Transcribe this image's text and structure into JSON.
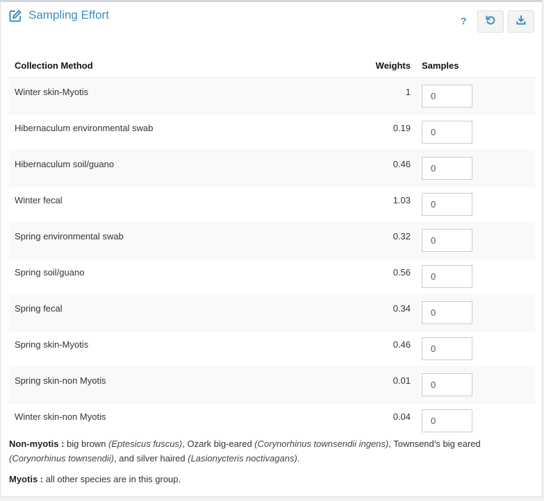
{
  "header": {
    "title": "Sampling Effort",
    "help_label": "?",
    "icons": {
      "title": "edit-icon",
      "reset": "undo-icon",
      "download": "download-icon"
    }
  },
  "table": {
    "columns": [
      "Collection Method",
      "Weights",
      "Samples"
    ],
    "rows": [
      {
        "method": "Winter skin-Myotis",
        "weight": "1",
        "samples": "0"
      },
      {
        "method": "Hibernaculum environmental swab",
        "weight": "0.19",
        "samples": "0"
      },
      {
        "method": "Hibernaculum soil/guano",
        "weight": "0.46",
        "samples": "0"
      },
      {
        "method": "Winter fecal",
        "weight": "1.03",
        "samples": "0"
      },
      {
        "method": "Spring environmental swab",
        "weight": "0.32",
        "samples": "0"
      },
      {
        "method": "Spring soil/guano",
        "weight": "0.56",
        "samples": "0"
      },
      {
        "method": "Spring fecal",
        "weight": "0.34",
        "samples": "0"
      },
      {
        "method": "Spring skin-Myotis",
        "weight": "0.46",
        "samples": "0"
      },
      {
        "method": "Spring skin-non Myotis",
        "weight": "0.01",
        "samples": "0"
      },
      {
        "method": "Winter skin-non Myotis",
        "weight": "0.04",
        "samples": "0"
      }
    ]
  },
  "notes": {
    "non_myotis": {
      "label": "Non-myotis",
      "separator": " : ",
      "p1": "big brown ",
      "i1": "(Eptesicus fuscus)",
      "p2": ", Ozark big-eared ",
      "i2": "(Corynorhinus townsendii ingens)",
      "p3": ", Townsend’s big eared ",
      "i3": "(Corynorhinus townsendii)",
      "p4": ", and silver haired ",
      "i4": "(Lasionycteris noctivagans)",
      "p5": "."
    },
    "myotis": {
      "label": "Myotis",
      "separator": " : ",
      "text": "all other species are in this group."
    }
  },
  "colors": {
    "accent": "#3c8dbc",
    "stripe": "#f9f9f9",
    "border": "#d2d6de"
  }
}
